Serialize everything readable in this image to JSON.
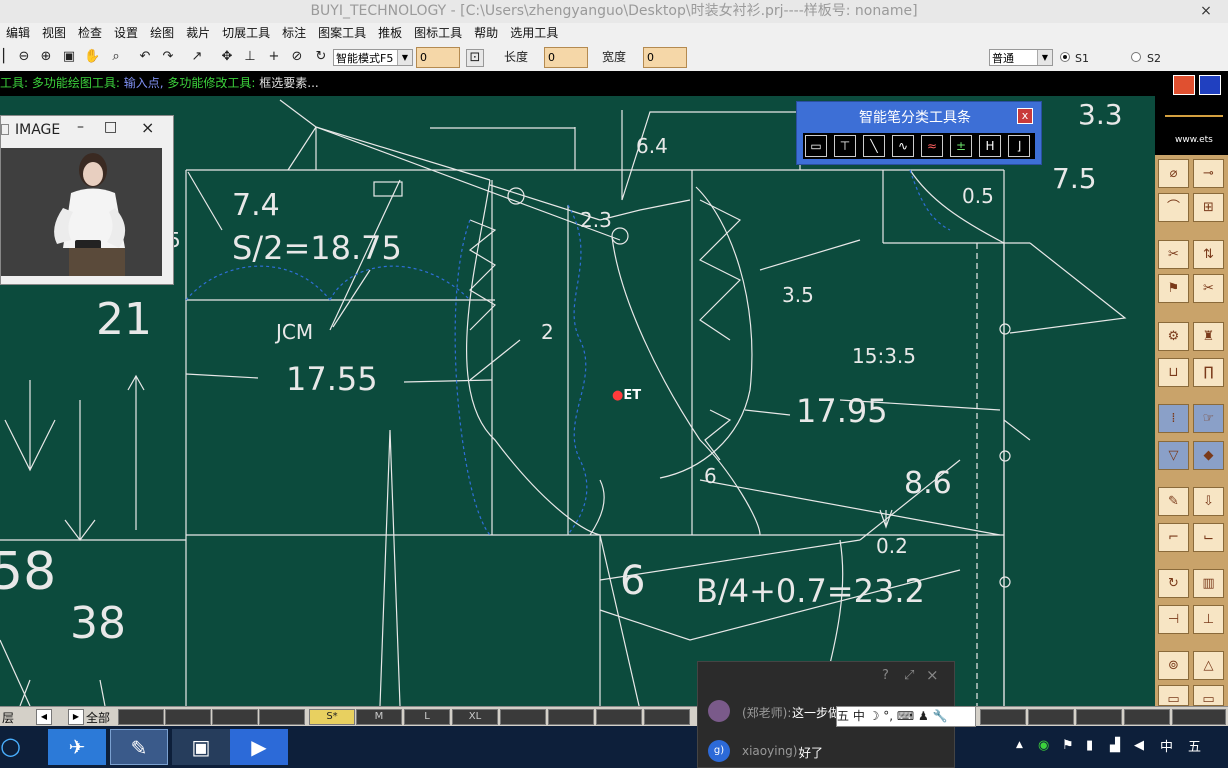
{
  "window": {
    "title": "BUYI_TECHNOLOGY - [C:\\Users\\zhengyanguo\\Desktop\\时装女衬衫.prj----样板号: noname]",
    "close_glyph": "×"
  },
  "menu": [
    "编辑",
    "视图",
    "检查",
    "设置",
    "绘图",
    "裁片",
    "切展工具",
    "标注",
    "图案工具",
    "推板",
    "图标工具",
    "帮助",
    "选用工具"
  ],
  "toolbar": {
    "mode_select": "智能模式F5",
    "field1_value": "0",
    "length_label": "长度",
    "length_value": "0",
    "width_label": "宽度",
    "width_value": "0",
    "style_select": "普通",
    "radio1_label": "S1",
    "radio2_label": "S2"
  },
  "prompt": {
    "part1": "工具:",
    "part2": "多功能绘图工具:",
    "part3": "输入点,",
    "part4": "多功能修改工具:",
    "part5": "框选要素..."
  },
  "image_window": {
    "title": "IMAGE",
    "min": "–",
    "max": "□",
    "close": "×"
  },
  "pen_toolbar": {
    "title": "智能笔分类工具条",
    "close": "x",
    "buttons": [
      "▭",
      "⊤",
      "╲",
      "∿",
      "≈",
      "±",
      "H",
      "⌋"
    ]
  },
  "canvas_labels": {
    "l33": "3.3",
    "l75": "7.5",
    "l05": "0.5",
    "l64": "6.4",
    "l23": "2.3",
    "l74": "7.4",
    "s2": "S/2=18.75",
    "l21": "21",
    "jcm": "JCM",
    "l2": "2",
    "l35": "3.5",
    "l1535": "15:3.5",
    "l1755": "17.55",
    "et": "ET",
    "l1795": "17.95",
    "l86": "8.6",
    "l6a": "6",
    "l02": "0.2",
    "l6b": "6",
    "b4": "B/4+0.7=23.2",
    "l58": "58",
    "l38": "38",
    "l5": "5"
  },
  "status_bar": {
    "layer_label": "层",
    "all_label": "全部",
    "sizes": [
      "S*",
      "M",
      "L",
      "XL"
    ]
  },
  "chat": {
    "msg1_user": "(郑老师):",
    "msg1_text": "这一步做完了",
    "msg2_user": "xiaoying):",
    "msg2_text": "好了"
  },
  "ime": {
    "text": "五 中 ☽ °, ⌨ ♟ 🔧"
  },
  "tray": {
    "lang": "中",
    "ime": "五"
  },
  "colors": {
    "canvas": "#0c4b3d",
    "line": "#e8e8e8",
    "dashed": "#2f6fd8",
    "prompt_green": "#3cd23c",
    "prompt_blue": "#7e8ef0"
  }
}
